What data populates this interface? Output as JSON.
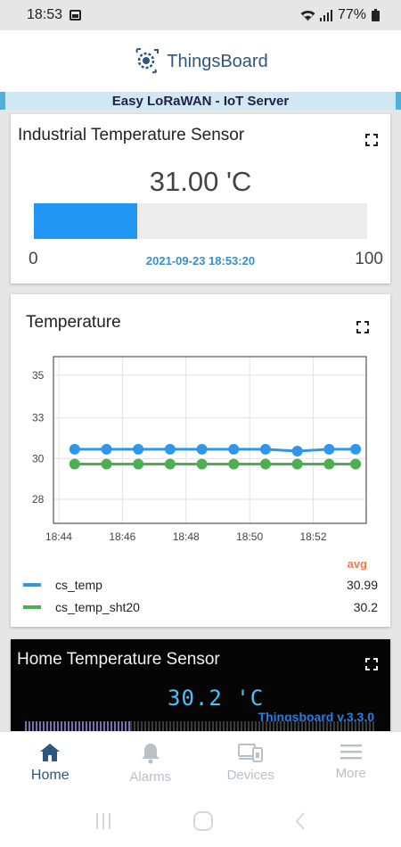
{
  "status_bar": {
    "time": "18:53",
    "battery": "77%",
    "icons": [
      "image-icon",
      "wifi-icon",
      "signal-icon",
      "battery-icon"
    ]
  },
  "header": {
    "brand": "ThingsBoard",
    "logo_icon": "thingsboard-logo-icon",
    "subtitle": "Easy LoRaWAN - IoT Server"
  },
  "card1": {
    "title": "Industrial Temperature Sensor",
    "value": "31.00 'C",
    "min": "0",
    "max": "100",
    "progress_percent": 31,
    "timestamp": "2021-09-23 18:53:20",
    "fill_color": "#2196f3"
  },
  "card2": {
    "title": "Temperature",
    "legend_header": "avg",
    "legend": [
      {
        "name": "cs_temp",
        "value": "30.99",
        "color": "#2f96ea"
      },
      {
        "name": "cs_temp_sht20",
        "value": "30.2",
        "color": "#4caf50"
      }
    ]
  },
  "chart_data": {
    "type": "line",
    "title": "Temperature",
    "xlabel": "",
    "ylabel": "",
    "x_tick_labels": [
      "18:44",
      "18:46",
      "18:48",
      "18:50",
      "18:52"
    ],
    "y_tick_labels": [
      "35",
      "33",
      "30",
      "28"
    ],
    "ylim": [
      27,
      36
    ],
    "grid": true,
    "x": [
      "18:44:30",
      "18:45:30",
      "18:46:30",
      "18:47:30",
      "18:48:30",
      "18:49:30",
      "18:50:30",
      "18:51:30",
      "18:52:30",
      "18:53:20"
    ],
    "series": [
      {
        "name": "cs_temp",
        "color": "#2f96ea",
        "values": [
          31.0,
          31.0,
          31.0,
          31.0,
          31.0,
          31.0,
          31.0,
          30.9,
          31.0,
          31.0
        ]
      },
      {
        "name": "cs_temp_sht20",
        "color": "#4caf50",
        "values": [
          30.2,
          30.2,
          30.2,
          30.2,
          30.2,
          30.2,
          30.2,
          30.2,
          30.2,
          30.2
        ]
      }
    ]
  },
  "card3": {
    "title": "Home Temperature Sensor",
    "value": "30.2 'C",
    "version": "Thingsboard v.3.3.0"
  },
  "bottom_nav": {
    "items": [
      {
        "label": "Home",
        "icon": "home-icon",
        "active": true
      },
      {
        "label": "Alarms",
        "icon": "bell-icon",
        "active": false
      },
      {
        "label": "Devices",
        "icon": "devices-icon",
        "active": false
      },
      {
        "label": "More",
        "icon": "menu-icon",
        "active": false
      }
    ]
  },
  "system_nav": {
    "icons": [
      "recent-apps-icon",
      "home-circle-icon",
      "back-icon"
    ]
  }
}
